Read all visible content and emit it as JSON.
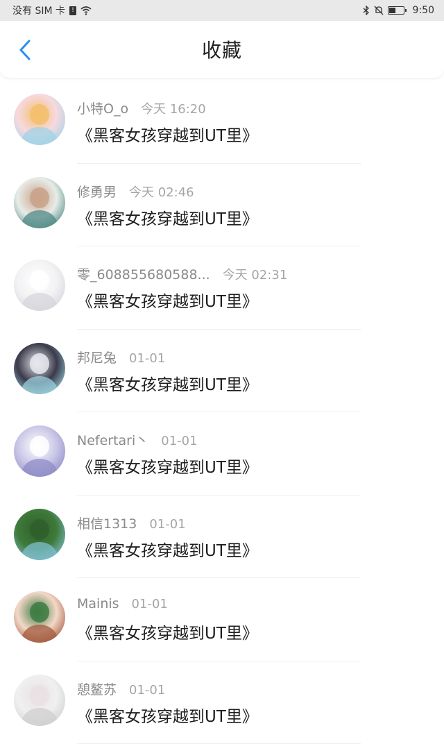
{
  "status_bar": {
    "carrier": "没有 SIM 卡",
    "time": "9:50",
    "battery_level": 0.45
  },
  "header": {
    "title": "收藏",
    "back_icon": "chevron-left-icon",
    "accent_color": "#2a8ef0"
  },
  "items": [
    {
      "user": "小特O_o",
      "time": "今天 16:20",
      "content": "《黑客女孩穿越到UT里》",
      "avatar_colors": [
        "#f7d9e0",
        "#9fd3e6",
        "#f3c06c"
      ]
    },
    {
      "user": "修勇男",
      "time": "今天 02:46",
      "content": "《黑客女孩穿越到UT里》",
      "avatar_colors": [
        "#e8ece8",
        "#4f8a86",
        "#c9a28a"
      ]
    },
    {
      "user": "零_608855680588...",
      "time": "今天 02:31",
      "content": "《黑客女孩穿越到UT里》",
      "avatar_colors": [
        "#f2f2f4",
        "#d6d6dc",
        "#ffffff"
      ]
    },
    {
      "user": "邦尼兔",
      "time": "01-01",
      "content": "《黑客女孩穿越到UT里》",
      "avatar_colors": [
        "#3a3a4a",
        "#9ad0dc",
        "#e7e7ef"
      ]
    },
    {
      "user": "Nefertari丶",
      "time": "01-01",
      "content": "《黑客女孩穿越到UT里》",
      "avatar_colors": [
        "#c9c6e6",
        "#8f8cc7",
        "#ffffff"
      ]
    },
    {
      "user": "相信1313",
      "time": "01-01",
      "content": "《黑客女孩穿越到UT里》",
      "avatar_colors": [
        "#3f7a3a",
        "#7dbfcf",
        "#2f5f2b"
      ]
    },
    {
      "user": "Mainis",
      "time": "01-01",
      "content": "《黑客女孩穿越到UT里》",
      "avatar_colors": [
        "#f3d8c8",
        "#a2593e",
        "#3e7b43"
      ]
    },
    {
      "user": "憩鳌苏",
      "time": "01-01",
      "content": "《黑客女孩穿越到UT里》",
      "avatar_colors": [
        "#f0f0f0",
        "#cfcfcf",
        "#e9e0e3"
      ]
    }
  ]
}
